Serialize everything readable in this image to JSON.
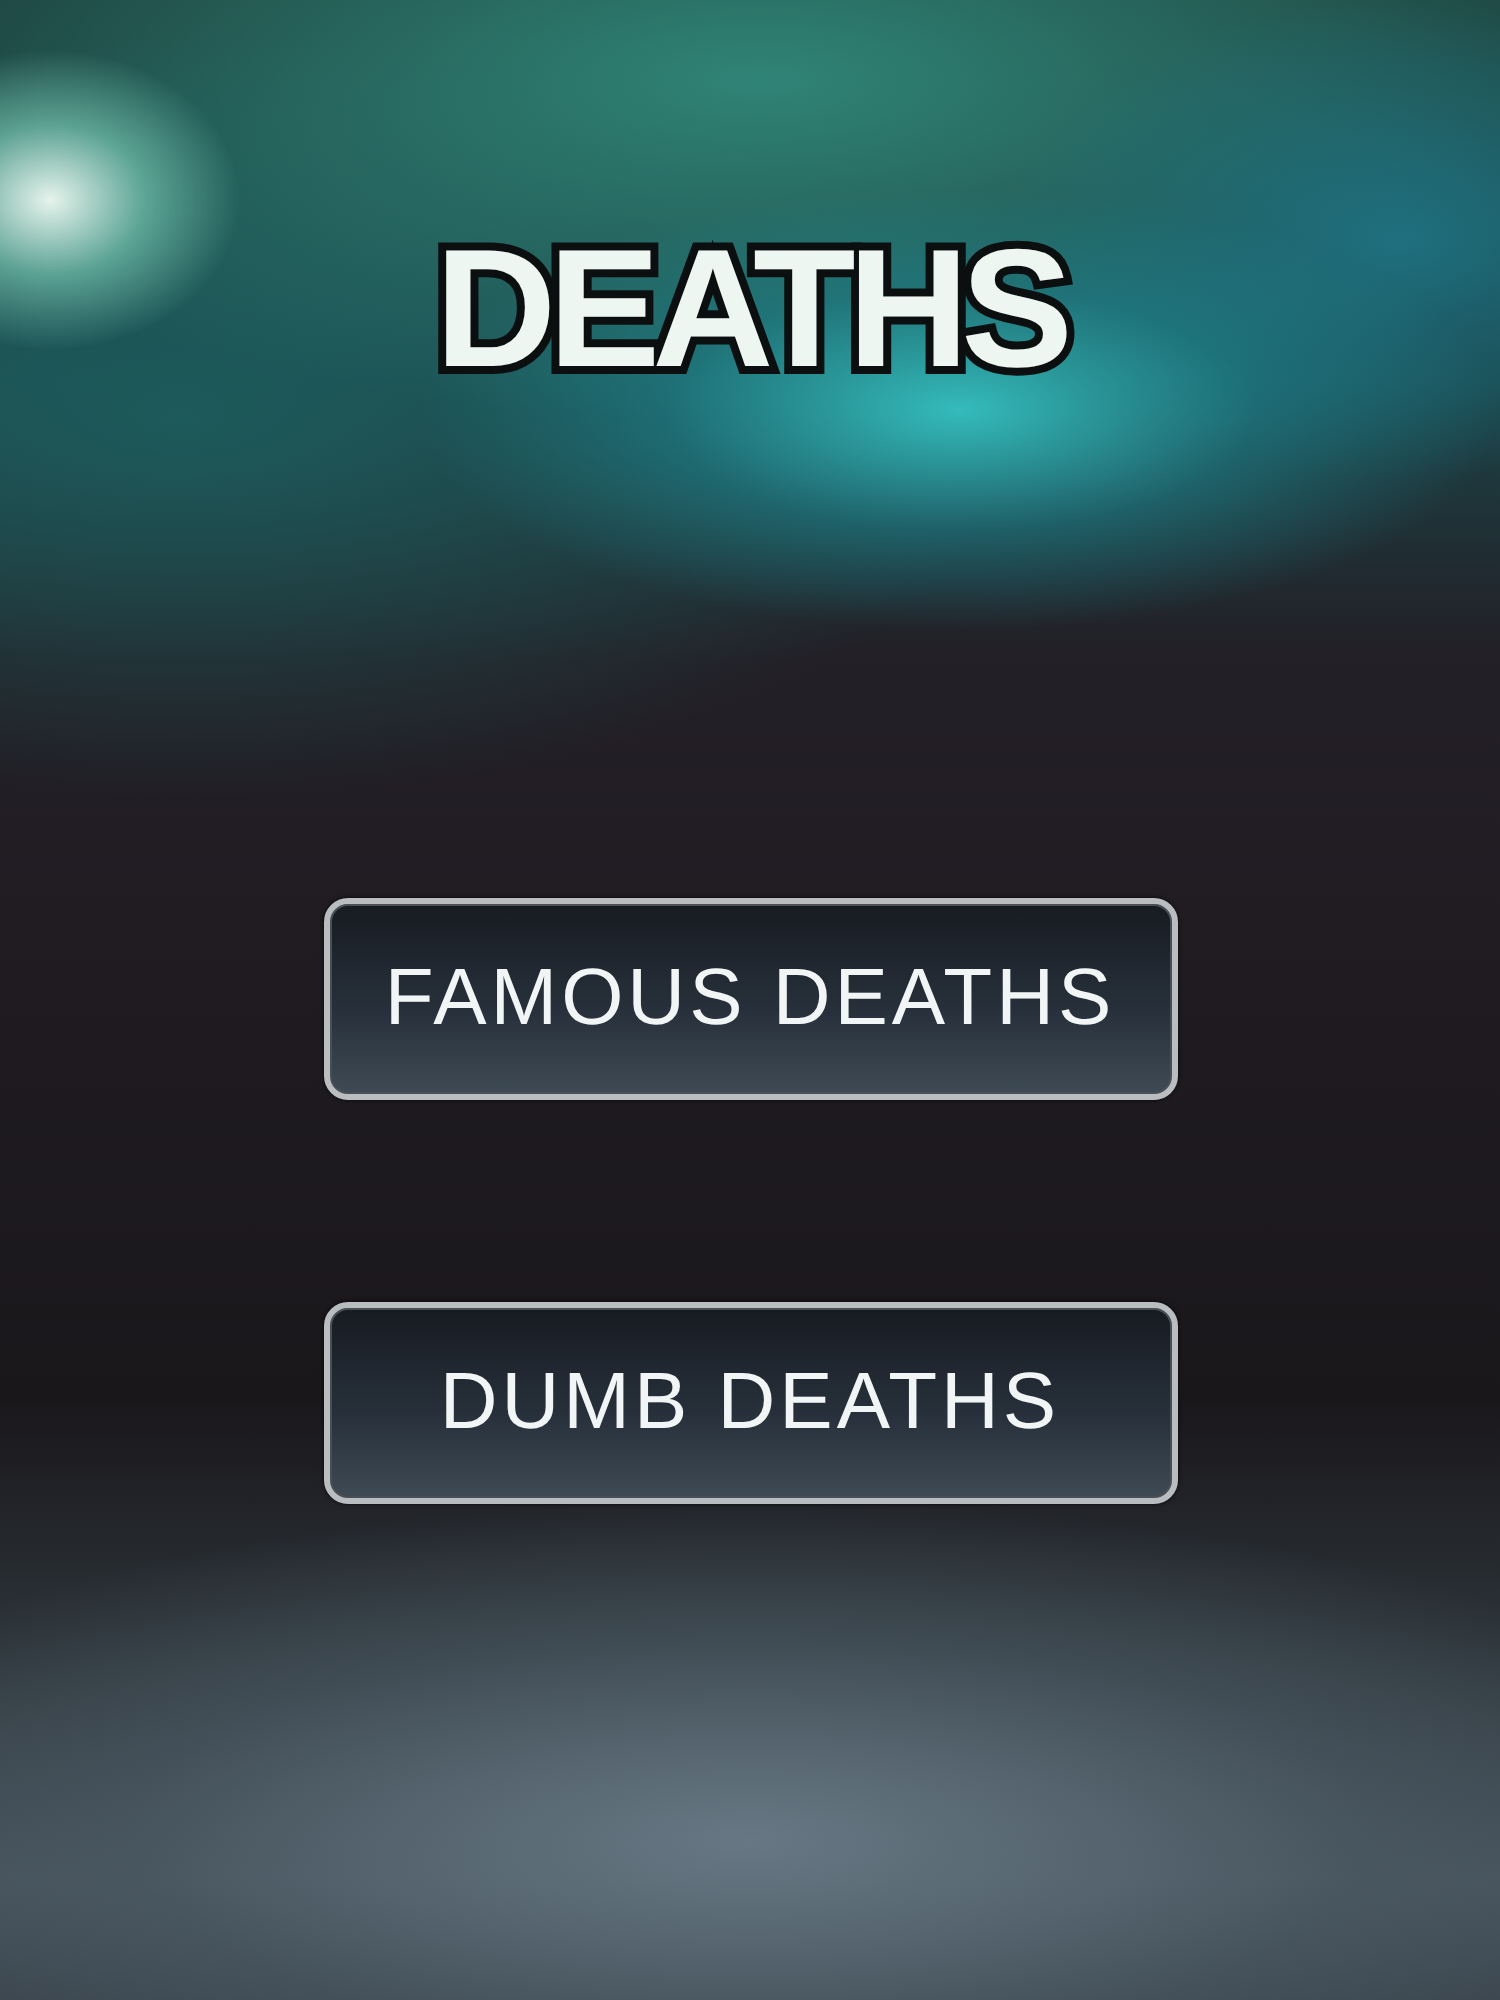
{
  "title": "DEATHS",
  "buttons": [
    {
      "label": "FAMOUS DEATHS"
    },
    {
      "label": "DUMB DEATHS"
    }
  ]
}
